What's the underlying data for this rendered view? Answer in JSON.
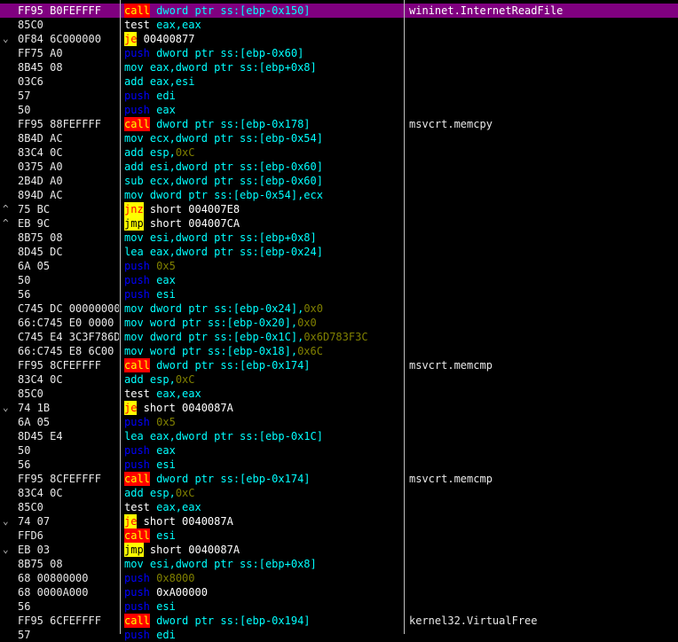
{
  "colors": {
    "background": "#000000",
    "selected_row": "#800080",
    "call_bg": "#ff0000",
    "call_fg": "#ffff00",
    "jcc_bg": "#ffff00",
    "jcc_fg": "#ff0000",
    "jmp_bg": "#ffff00",
    "push": "#0000ff",
    "mov_operands": "#00ffff",
    "immediate": "#808000",
    "text": "#e8e8e8"
  },
  "rows": [
    {
      "arrow": "",
      "bytes": "FF95 B0FEFFFF",
      "mnemonic": "call",
      "mclass": "call",
      "parts": [
        {
          "t": " dword ptr ss:[ebp-0x150]",
          "c": "op"
        }
      ],
      "comment": "wininet.InternetReadFile",
      "selected": true
    },
    {
      "arrow": "",
      "bytes": "85C0",
      "mnemonic": "test",
      "mclass": "test",
      "parts": [
        {
          "t": " eax,eax",
          "c": "op"
        }
      ],
      "comment": ""
    },
    {
      "arrow": "⌄",
      "bytes": "0F84 6C000000",
      "mnemonic": "je",
      "mclass": "jcc",
      "parts": [
        {
          "t": " 00400877",
          "c": "op-jmp"
        }
      ],
      "comment": ""
    },
    {
      "arrow": "",
      "bytes": "FF75 A0",
      "mnemonic": "push",
      "mclass": "push",
      "parts": [
        {
          "t": " dword ptr ss:[ebp-0x60]",
          "c": "op"
        }
      ],
      "comment": ""
    },
    {
      "arrow": "",
      "bytes": "8B45 08",
      "mnemonic": "mov",
      "mclass": "mov",
      "parts": [
        {
          "t": " eax,dword ptr ss:[ebp+0x8]",
          "c": "op"
        }
      ],
      "comment": ""
    },
    {
      "arrow": "",
      "bytes": "03C6",
      "mnemonic": "add",
      "mclass": "arith",
      "parts": [
        {
          "t": " eax,esi",
          "c": "op"
        }
      ],
      "comment": ""
    },
    {
      "arrow": "",
      "bytes": "57",
      "mnemonic": "push",
      "mclass": "push",
      "parts": [
        {
          "t": " edi",
          "c": "op"
        }
      ],
      "comment": ""
    },
    {
      "arrow": "",
      "bytes": "50",
      "mnemonic": "push",
      "mclass": "push",
      "parts": [
        {
          "t": " eax",
          "c": "op"
        }
      ],
      "comment": ""
    },
    {
      "arrow": "",
      "bytes": "FF95 88FEFFFF",
      "mnemonic": "call",
      "mclass": "call",
      "parts": [
        {
          "t": " dword ptr ss:[ebp-0x178]",
          "c": "op"
        }
      ],
      "comment": "msvcrt.memcpy"
    },
    {
      "arrow": "",
      "bytes": "8B4D AC",
      "mnemonic": "mov",
      "mclass": "mov",
      "parts": [
        {
          "t": " ecx,dword ptr ss:[ebp-0x54]",
          "c": "op"
        }
      ],
      "comment": ""
    },
    {
      "arrow": "",
      "bytes": "83C4 0C",
      "mnemonic": "add",
      "mclass": "arith",
      "parts": [
        {
          "t": " esp,",
          "c": "op"
        },
        {
          "t": "0xC",
          "c": "op-imm"
        }
      ],
      "comment": ""
    },
    {
      "arrow": "",
      "bytes": "0375 A0",
      "mnemonic": "add",
      "mclass": "arith",
      "parts": [
        {
          "t": " esi,dword ptr ss:[ebp-0x60]",
          "c": "op"
        }
      ],
      "comment": ""
    },
    {
      "arrow": "",
      "bytes": "2B4D A0",
      "mnemonic": "sub",
      "mclass": "arith",
      "parts": [
        {
          "t": " ecx,dword ptr ss:[ebp-0x60]",
          "c": "op"
        }
      ],
      "comment": ""
    },
    {
      "arrow": "",
      "bytes": "894D AC",
      "mnemonic": "mov",
      "mclass": "mov",
      "parts": [
        {
          "t": " dword ptr ss:[ebp-0x54],ecx",
          "c": "op"
        }
      ],
      "comment": ""
    },
    {
      "arrow": "^",
      "bytes": "75 BC",
      "mnemonic": "jnz",
      "mclass": "jcc",
      "parts": [
        {
          "t": " short 004007E8",
          "c": "op-jmp"
        }
      ],
      "comment": ""
    },
    {
      "arrow": "^",
      "bytes": "EB 9C",
      "mnemonic": "jmp",
      "mclass": "jmp",
      "parts": [
        {
          "t": " short 004007CA",
          "c": "op-jmp"
        }
      ],
      "comment": ""
    },
    {
      "arrow": "",
      "bytes": "8B75 08",
      "mnemonic": "mov",
      "mclass": "mov",
      "parts": [
        {
          "t": " esi,dword ptr ss:[ebp+0x8]",
          "c": "op"
        }
      ],
      "comment": ""
    },
    {
      "arrow": "",
      "bytes": "8D45 DC",
      "mnemonic": "lea",
      "mclass": "mov",
      "parts": [
        {
          "t": " eax,dword ptr ss:[ebp-0x24]",
          "c": "op"
        }
      ],
      "comment": ""
    },
    {
      "arrow": "",
      "bytes": "6A 05",
      "mnemonic": "push",
      "mclass": "push",
      "parts": [
        {
          "t": " ",
          "c": "op"
        },
        {
          "t": "0x5",
          "c": "op-imm"
        }
      ],
      "comment": ""
    },
    {
      "arrow": "",
      "bytes": "50",
      "mnemonic": "push",
      "mclass": "push",
      "parts": [
        {
          "t": " eax",
          "c": "op"
        }
      ],
      "comment": ""
    },
    {
      "arrow": "",
      "bytes": "56",
      "mnemonic": "push",
      "mclass": "push",
      "parts": [
        {
          "t": " esi",
          "c": "op"
        }
      ],
      "comment": ""
    },
    {
      "arrow": "",
      "bytes": "C745 DC 00000000",
      "mnemonic": "mov",
      "mclass": "mov",
      "parts": [
        {
          "t": " dword ptr ss:[ebp-0x24],",
          "c": "op"
        },
        {
          "t": "0x0",
          "c": "op-imm"
        }
      ],
      "comment": ""
    },
    {
      "arrow": "",
      "bytes": "66:C745 E0 0000",
      "mnemonic": "mov",
      "mclass": "mov",
      "parts": [
        {
          "t": " word ptr ss:[ebp-0x20],",
          "c": "op"
        },
        {
          "t": "0x0",
          "c": "op-imm"
        }
      ],
      "comment": ""
    },
    {
      "arrow": "",
      "bytes": "C745 E4 3C3F786D",
      "mnemonic": "mov",
      "mclass": "mov",
      "parts": [
        {
          "t": " dword ptr ss:[ebp-0x1C],",
          "c": "op"
        },
        {
          "t": "0x6D783F3C",
          "c": "op-imm"
        }
      ],
      "comment": ""
    },
    {
      "arrow": "",
      "bytes": "66:C745 E8 6C00",
      "mnemonic": "mov",
      "mclass": "mov",
      "parts": [
        {
          "t": " word ptr ss:[ebp-0x18],",
          "c": "op"
        },
        {
          "t": "0x6C",
          "c": "op-imm"
        }
      ],
      "comment": ""
    },
    {
      "arrow": "",
      "bytes": "FF95 8CFEFFFF",
      "mnemonic": "call",
      "mclass": "call",
      "parts": [
        {
          "t": " dword ptr ss:[ebp-0x174]",
          "c": "op"
        }
      ],
      "comment": "msvcrt.memcmp"
    },
    {
      "arrow": "",
      "bytes": "83C4 0C",
      "mnemonic": "add",
      "mclass": "arith",
      "parts": [
        {
          "t": " esp,",
          "c": "op"
        },
        {
          "t": "0xC",
          "c": "op-imm"
        }
      ],
      "comment": ""
    },
    {
      "arrow": "",
      "bytes": "85C0",
      "mnemonic": "test",
      "mclass": "test",
      "parts": [
        {
          "t": " eax,eax",
          "c": "op"
        }
      ],
      "comment": ""
    },
    {
      "arrow": "⌄",
      "bytes": "74 1B",
      "mnemonic": "je",
      "mclass": "jcc",
      "parts": [
        {
          "t": " short 0040087A",
          "c": "op-jmp"
        }
      ],
      "comment": ""
    },
    {
      "arrow": "",
      "bytes": "6A 05",
      "mnemonic": "push",
      "mclass": "push",
      "parts": [
        {
          "t": " ",
          "c": "op"
        },
        {
          "t": "0x5",
          "c": "op-imm"
        }
      ],
      "comment": ""
    },
    {
      "arrow": "",
      "bytes": "8D45 E4",
      "mnemonic": "lea",
      "mclass": "mov",
      "parts": [
        {
          "t": " eax,dword ptr ss:[ebp-0x1C]",
          "c": "op"
        }
      ],
      "comment": ""
    },
    {
      "arrow": "",
      "bytes": "50",
      "mnemonic": "push",
      "mclass": "push",
      "parts": [
        {
          "t": " eax",
          "c": "op"
        }
      ],
      "comment": ""
    },
    {
      "arrow": "",
      "bytes": "56",
      "mnemonic": "push",
      "mclass": "push",
      "parts": [
        {
          "t": " esi",
          "c": "op"
        }
      ],
      "comment": ""
    },
    {
      "arrow": "",
      "bytes": "FF95 8CFEFFFF",
      "mnemonic": "call",
      "mclass": "call",
      "parts": [
        {
          "t": " dword ptr ss:[ebp-0x174]",
          "c": "op"
        }
      ],
      "comment": "msvcrt.memcmp"
    },
    {
      "arrow": "",
      "bytes": "83C4 0C",
      "mnemonic": "add",
      "mclass": "arith",
      "parts": [
        {
          "t": " esp,",
          "c": "op"
        },
        {
          "t": "0xC",
          "c": "op-imm"
        }
      ],
      "comment": ""
    },
    {
      "arrow": "",
      "bytes": "85C0",
      "mnemonic": "test",
      "mclass": "test",
      "parts": [
        {
          "t": " eax,eax",
          "c": "op"
        }
      ],
      "comment": ""
    },
    {
      "arrow": "⌄",
      "bytes": "74 07",
      "mnemonic": "je",
      "mclass": "jcc",
      "parts": [
        {
          "t": " short 0040087A",
          "c": "op-jmp"
        }
      ],
      "comment": ""
    },
    {
      "arrow": "",
      "bytes": "FFD6",
      "mnemonic": "call",
      "mclass": "call",
      "parts": [
        {
          "t": " esi",
          "c": "op"
        }
      ],
      "comment": ""
    },
    {
      "arrow": "⌄",
      "bytes": "EB 03",
      "mnemonic": "jmp",
      "mclass": "jmp",
      "parts": [
        {
          "t": " short 0040087A",
          "c": "op-jmp"
        }
      ],
      "comment": ""
    },
    {
      "arrow": "",
      "bytes": "8B75 08",
      "mnemonic": "mov",
      "mclass": "mov",
      "parts": [
        {
          "t": " esi,dword ptr ss:[ebp+0x8]",
          "c": "op"
        }
      ],
      "comment": ""
    },
    {
      "arrow": "",
      "bytes": "68 00800000",
      "mnemonic": "push",
      "mclass": "push",
      "parts": [
        {
          "t": " ",
          "c": "op"
        },
        {
          "t": "0x8000",
          "c": "op-imm"
        }
      ],
      "comment": ""
    },
    {
      "arrow": "",
      "bytes": "68 0000A000",
      "mnemonic": "push",
      "mclass": "push",
      "parts": [
        {
          "t": " 0xA00000",
          "c": "op-jmp"
        }
      ],
      "comment": ""
    },
    {
      "arrow": "",
      "bytes": "56",
      "mnemonic": "push",
      "mclass": "push",
      "parts": [
        {
          "t": " esi",
          "c": "op"
        }
      ],
      "comment": ""
    },
    {
      "arrow": "",
      "bytes": "FF95 6CFEFFFF",
      "mnemonic": "call",
      "mclass": "call",
      "parts": [
        {
          "t": " dword ptr ss:[ebp-0x194]",
          "c": "op"
        }
      ],
      "comment": "kernel32.VirtualFree"
    },
    {
      "arrow": "",
      "bytes": "57",
      "mnemonic": "push",
      "mclass": "push",
      "parts": [
        {
          "t": " edi",
          "c": "op"
        }
      ],
      "comment": ""
    }
  ]
}
